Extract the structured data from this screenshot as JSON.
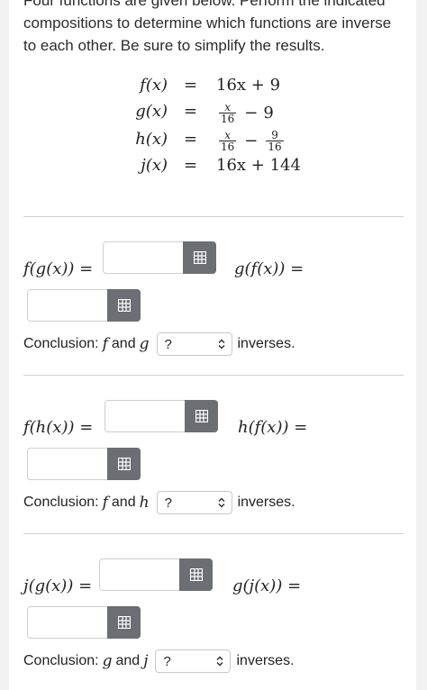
{
  "intro": "Four functions are given below. Perform the indicated compositions to determine which functions are inverse to each other. Be sure to simplify the results.",
  "functions": {
    "f": {
      "lhs": "f(x)",
      "sign": "=",
      "rhs": "16x + 9"
    },
    "g": {
      "lhs": "g(x)",
      "sign": "=",
      "frac_num": "x",
      "frac_den": "16",
      "op": "−",
      "tail": "9"
    },
    "h": {
      "lhs": "h(x)",
      "sign": "=",
      "frac1_num": "x",
      "frac1_den": "16",
      "op": "−",
      "frac2_num": "9",
      "frac2_den": "16"
    },
    "j": {
      "lhs": "j(x)",
      "sign": "=",
      "rhs": "16x + 144"
    }
  },
  "sections": [
    {
      "left_label": "f(g(x)) =",
      "right_label": "g(f(x)) =",
      "conclusion_prefix": "Conclusion:",
      "fn1": "f",
      "and": "and",
      "fn2": "g",
      "select_value": "?",
      "suffix": "inverses."
    },
    {
      "left_label": "f(h(x)) =",
      "right_label": "h(f(x)) =",
      "conclusion_prefix": "Conclusion:",
      "fn1": "f",
      "and": "and",
      "fn2": "h",
      "select_value": "?",
      "suffix": "inverses."
    },
    {
      "left_label": "j(g(x)) =",
      "right_label": "g(j(x)) =",
      "conclusion_prefix": "Conclusion:",
      "fn1": "g",
      "and": "and",
      "fn2": "j",
      "select_value": "?",
      "suffix": "inverses."
    }
  ],
  "icons": {
    "keypad": "keypad-icon",
    "select": "chevron-updown-icon"
  },
  "colors": {
    "keypad_button": "#6b6e72",
    "border": "#cfcfcf",
    "divider": "#cfcfcf"
  }
}
